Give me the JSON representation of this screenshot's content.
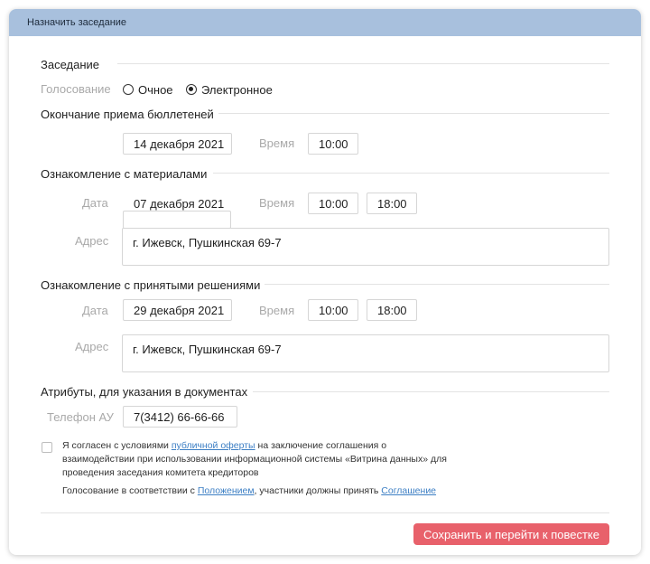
{
  "header": {
    "title": "Назначить заседание"
  },
  "meeting": {
    "title": "Заседание",
    "voting_label": "Голосование",
    "options": [
      "Очное",
      "Электронное"
    ],
    "selected": "Электронное"
  },
  "ballots_end": {
    "title": "Окончание приема бюллетеней",
    "date": "14 декабря 2021",
    "time_label": "Время",
    "time": "10:00"
  },
  "materials": {
    "title": "Ознакомление с материалами",
    "date_label": "Дата",
    "date": "07 декабря 2021",
    "time_label": "Время",
    "time_from": "10:00",
    "time_to": "18:00",
    "address_label": "Адрес",
    "address": "г. Ижевск, Пушкинская 69-7"
  },
  "decisions": {
    "title": "Ознакомление с принятыми решениями",
    "date_label": "Дата",
    "date": "29 декабря 2021",
    "time_label": "Время",
    "time_from": "10:00",
    "time_to": "18:00",
    "address_label": "Адрес",
    "address": "г. Ижевск, Пушкинская 69-7"
  },
  "attributes": {
    "title": "Атрибуты, для указания в документах",
    "phone_label": "Телефон АУ",
    "phone": "7(3412) 66-66-66"
  },
  "agreement": {
    "checked": false,
    "text_before": "Я согласен с условиями ",
    "offer_link": "публичной оферты",
    "text_after": " на заключение соглашения о взаимодействии при использовании информационной системы «Витрина данных» для проведения заседания комитета кредиторов",
    "note_before": "Голосование в соответствии с ",
    "regulation_link": "Положением",
    "note_middle": ", участники должны принять ",
    "agreement_link": "Соглашение"
  },
  "actions": {
    "submit_label": "Сохранить и перейти к повестке"
  },
  "colors": {
    "header_bg": "#a8c0dd",
    "accent": "#e8616b",
    "link": "#3d7fc4"
  }
}
